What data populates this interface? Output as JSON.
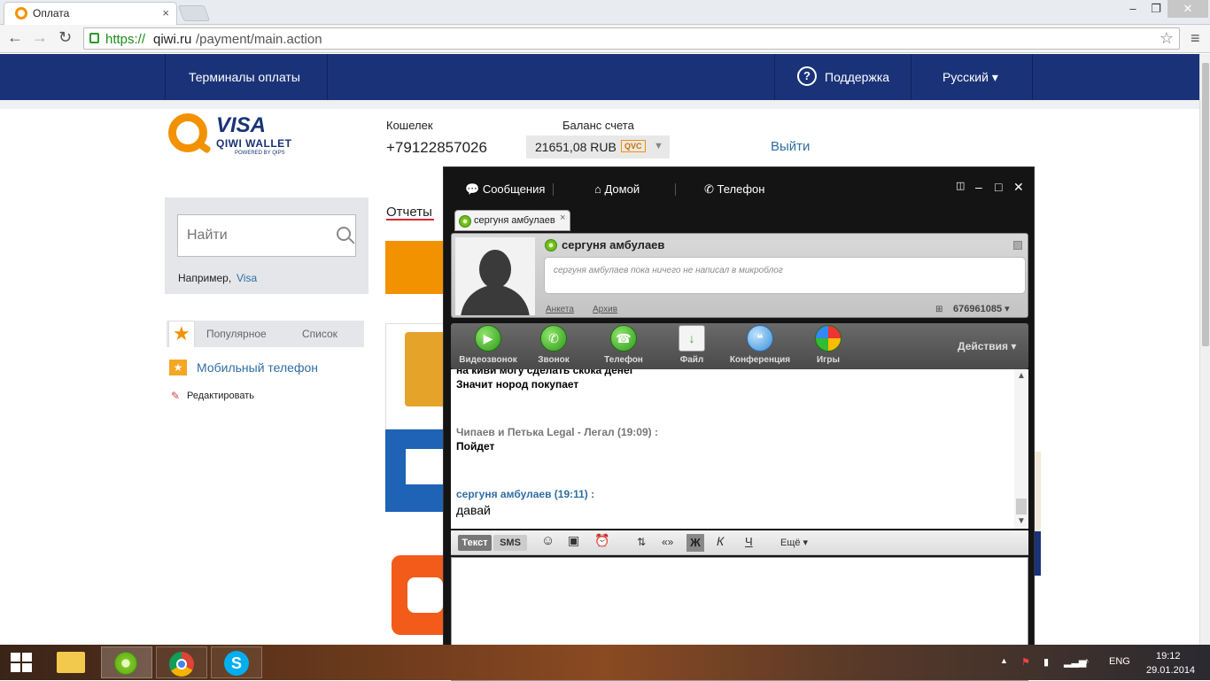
{
  "browser": {
    "tab_title": "Оплата",
    "tab_close": "×",
    "url_secure": "https://",
    "url_host": "qiwi.ru",
    "url_path": "/payment/main.action",
    "star": "☆",
    "menu": "≡",
    "back": "←",
    "forward": "→",
    "reload": "↻",
    "win_min": "–",
    "win_max": "❐",
    "win_close": "✕"
  },
  "nav": {
    "terminals": "Терминалы оплаты",
    "support": "Поддержка",
    "support_q": "?",
    "language": "Русский ▾"
  },
  "logo": {
    "visa": "VISA",
    "wallet": "QIWI WALLET",
    "powered": "POWERED BY QIPS"
  },
  "account": {
    "wallet_label": "Кошелек",
    "wallet_number": "+79122857026",
    "balance_label": "Баланс счета",
    "balance_value": "21651,08 RUB",
    "currency_badge": "QVC",
    "logout": "Выйти"
  },
  "search": {
    "placeholder": "Найти",
    "example_prefix": "Например,",
    "example_link": "Visa"
  },
  "reports": "Отчеты",
  "left_tabs": {
    "popular": "Популярное",
    "list": "Список"
  },
  "favorites": {
    "item": "Мобильный телефон",
    "edit": "Редактировать"
  },
  "icq": {
    "nav_messages": "Сообщения",
    "nav_home": "Домой",
    "nav_phone": "Телефон",
    "chat_tab_name": "сергуня амбулаев",
    "chat_tab_close": "×",
    "profile_name": "сергуня амбулаев",
    "microblog": "сергуня амбулаев пока ничего не написал в микроблог",
    "link_profile": "Анкета",
    "link_archive": "Архив",
    "uin": "676961085 ▾",
    "actions": [
      {
        "label": "Видеозвонок"
      },
      {
        "label": "Звонок"
      },
      {
        "label": "Телефон"
      },
      {
        "label": "Файл"
      },
      {
        "label": "Конференция"
      },
      {
        "label": "Игры"
      }
    ],
    "actions_menu": "Действия ▾",
    "history": {
      "line_cut": "на киви могу сделать скока денег",
      "line1": "Значит нород покупает",
      "sender2": "Чипаев и Петька Legal - Легал (19:09) :",
      "msg2": "Пойдет",
      "sender3": "сергуня амбулаев (19:11) :",
      "msg3": "давай"
    },
    "fmt": {
      "text": "Текст",
      "sms": "SMS",
      "bold": "Ж",
      "italic": "К",
      "underline": "Ч",
      "quote": "«»",
      "more": "Ещё ▾"
    }
  },
  "taskbar": {
    "lang": "ENG",
    "time": "19:12",
    "date": "29.01.2014"
  }
}
